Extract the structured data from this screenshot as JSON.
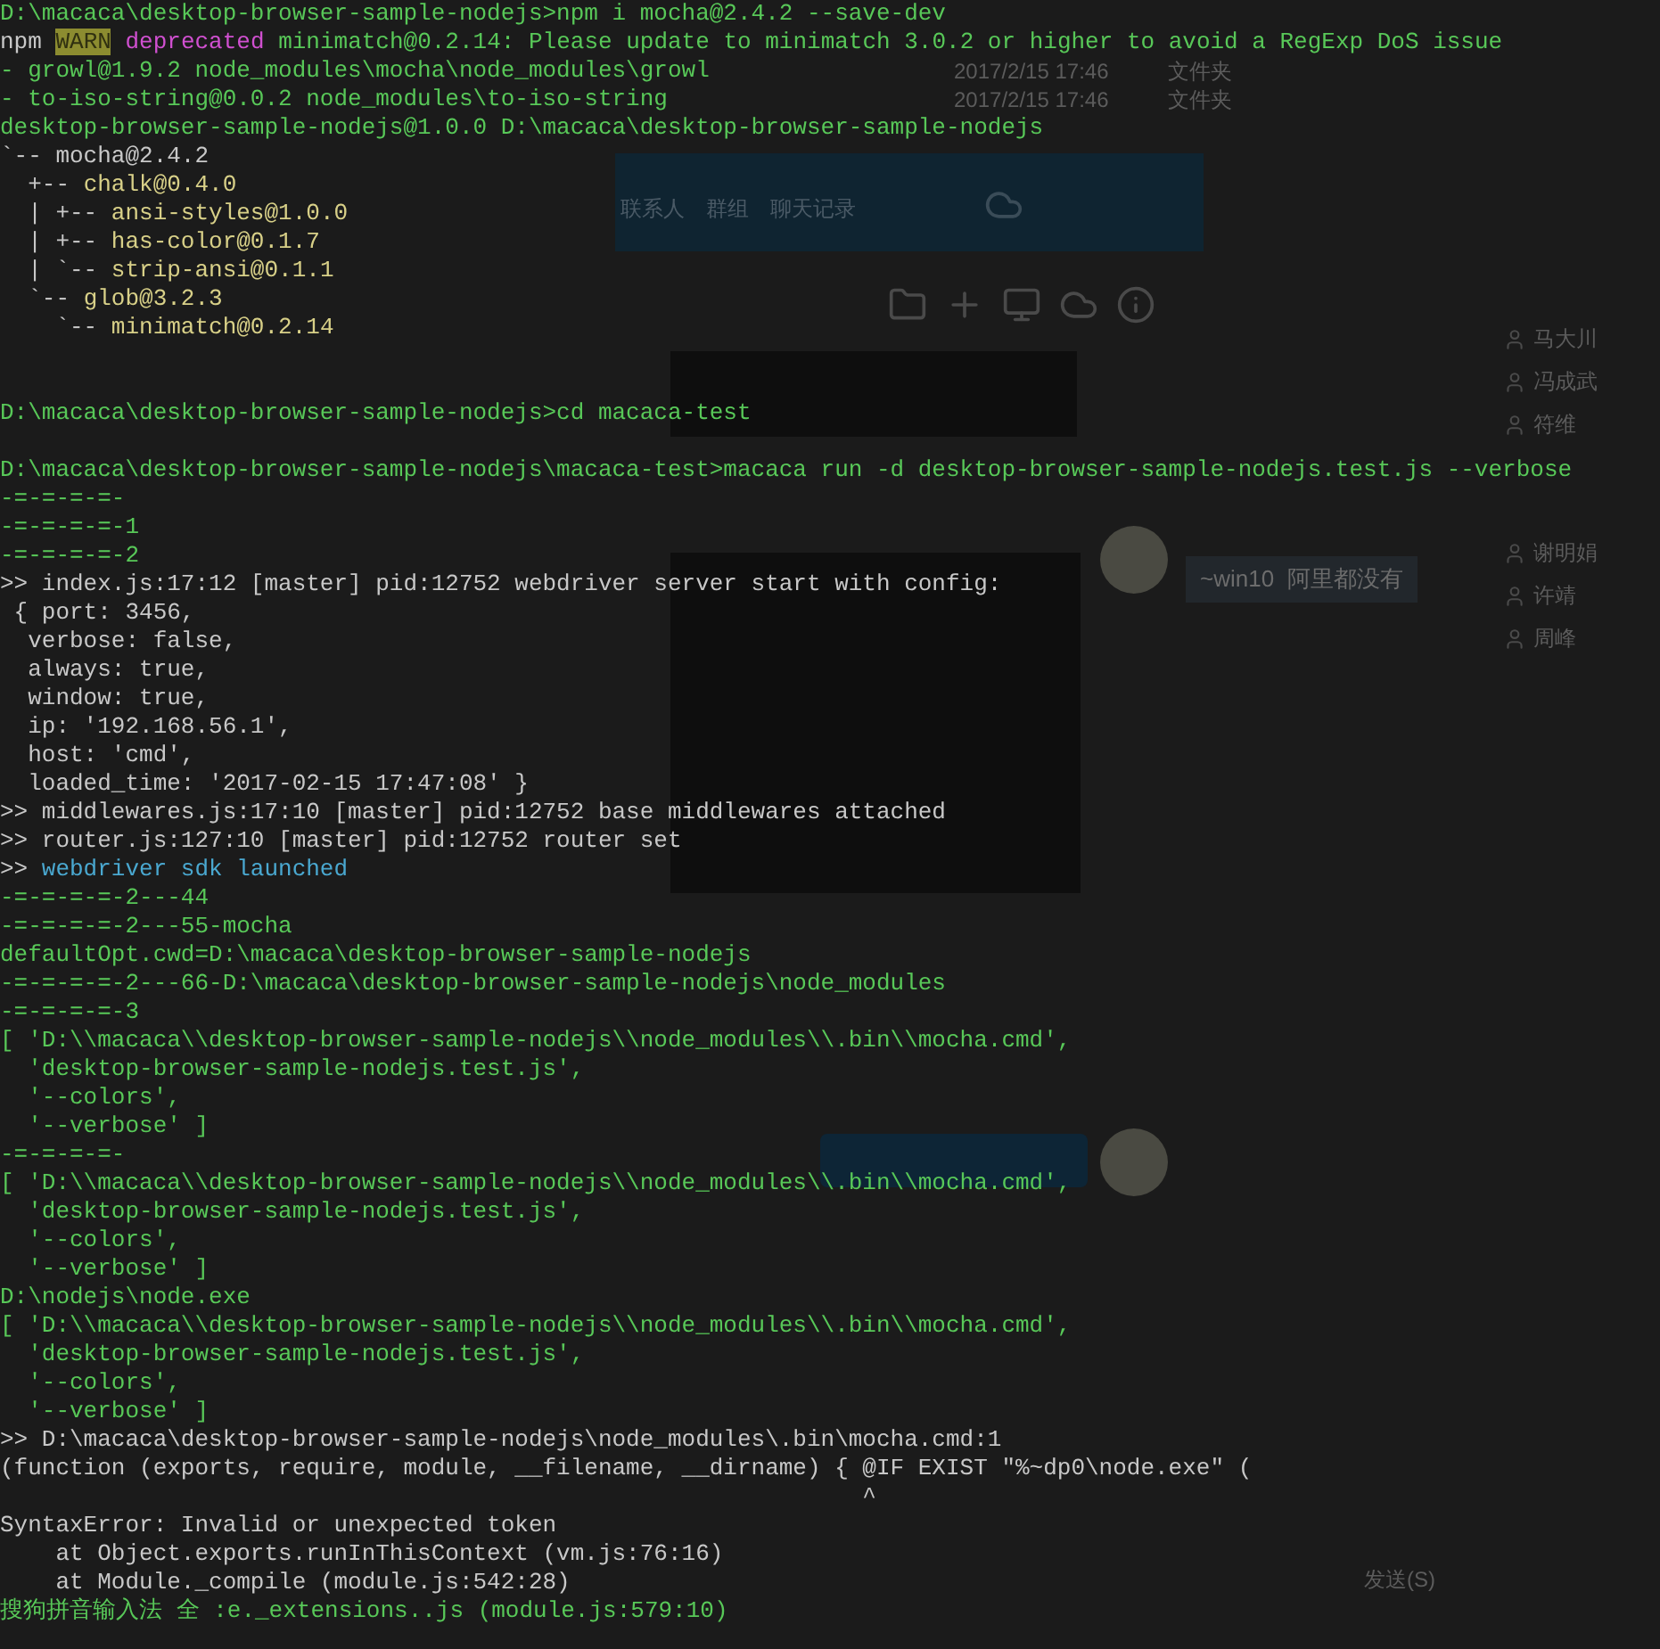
{
  "background_app": {
    "file_rows": [
      {
        "date": "2017/2/15 17:46",
        "type": "文件夹"
      },
      {
        "date": "2017/2/15 17:46",
        "type": "文件夹"
      }
    ],
    "tabs": [
      {
        "label": "联系人",
        "selected": false
      },
      {
        "label": "群组",
        "selected": false
      },
      {
        "label": "聊天记录",
        "selected": false
      }
    ],
    "contacts": [
      "马大川",
      "冯成武",
      "符维",
      "谢明娟",
      "许靖",
      "周峰"
    ],
    "message": "~win10  阿里都没有",
    "send_button": "发送(S)"
  },
  "terminal": {
    "lines": [
      {
        "segments": [
          {
            "kind": "prompt",
            "text": "D:\\macaca\\desktop-browser-sample-nodejs>npm i mocha@2.4.2 --save-dev"
          }
        ]
      },
      {
        "segments": [
          {
            "kind": "plain",
            "text": "npm "
          },
          {
            "kind": "warn",
            "text": "WARN"
          },
          {
            "kind": "deprecated",
            "text": " deprecated"
          },
          {
            "kind": "prompt",
            "text": " minimatch@0.2.14: Please update to minimatch 3.0.2 or higher to avoid a RegExp DoS issue"
          }
        ]
      },
      {
        "segments": [
          {
            "kind": "prompt",
            "text": "- growl@1.9.2 node_modules\\mocha\\node_modules\\growl"
          }
        ]
      },
      {
        "segments": [
          {
            "kind": "prompt",
            "text": "- to-iso-string@0.0.2 node_modules\\to-iso-string"
          }
        ]
      },
      {
        "segments": [
          {
            "kind": "prompt",
            "text": "desktop-browser-sample-nodejs@1.0.0 D:\\macaca\\desktop-browser-sample-nodejs"
          }
        ]
      },
      {
        "segments": [
          {
            "kind": "plain",
            "text": "`-- mocha@2.4.2"
          }
        ]
      },
      {
        "segments": [
          {
            "kind": "plain",
            "text": "  +-- "
          },
          {
            "kind": "tree",
            "text": "chalk@0.4.0"
          }
        ]
      },
      {
        "segments": [
          {
            "kind": "plain",
            "text": "  | +-- "
          },
          {
            "kind": "tree",
            "text": "ansi-styles@1.0.0"
          }
        ]
      },
      {
        "segments": [
          {
            "kind": "plain",
            "text": "  | +-- "
          },
          {
            "kind": "tree",
            "text": "has-color@0.1.7"
          }
        ]
      },
      {
        "segments": [
          {
            "kind": "plain",
            "text": "  | `-- "
          },
          {
            "kind": "tree",
            "text": "strip-ansi@0.1.1"
          }
        ]
      },
      {
        "segments": [
          {
            "kind": "plain",
            "text": "  `-- "
          },
          {
            "kind": "tree",
            "text": "glob@3.2.3"
          }
        ]
      },
      {
        "segments": [
          {
            "kind": "plain",
            "text": "    `-- "
          },
          {
            "kind": "tree",
            "text": "minimatch@0.2.14"
          }
        ]
      },
      {
        "kind": "blank"
      },
      {
        "kind": "blank"
      },
      {
        "segments": [
          {
            "kind": "prompt",
            "text": "D:\\macaca\\desktop-browser-sample-nodejs>cd macaca-test"
          }
        ]
      },
      {
        "kind": "blank"
      },
      {
        "segments": [
          {
            "kind": "prompt",
            "text": "D:\\macaca\\desktop-browser-sample-nodejs\\macaca-test>macaca run -d desktop-browser-sample-nodejs.test.js --verbose"
          }
        ]
      },
      {
        "segments": [
          {
            "kind": "prompt",
            "text": "-=-=-=-=-"
          }
        ]
      },
      {
        "segments": [
          {
            "kind": "prompt",
            "text": "-=-=-=-=-1"
          }
        ]
      },
      {
        "segments": [
          {
            "kind": "prompt",
            "text": "-=-=-=-=-2"
          }
        ]
      },
      {
        "segments": [
          {
            "kind": "plain",
            "text": ">> index.js:17:12 [master] pid:12752 webdriver server start with config:"
          }
        ]
      },
      {
        "segments": [
          {
            "kind": "plain",
            "text": " { port: 3456,"
          }
        ]
      },
      {
        "segments": [
          {
            "kind": "plain",
            "text": "  verbose: false,"
          }
        ]
      },
      {
        "segments": [
          {
            "kind": "plain",
            "text": "  always: true,"
          }
        ]
      },
      {
        "segments": [
          {
            "kind": "plain",
            "text": "  window: true,"
          }
        ]
      },
      {
        "segments": [
          {
            "kind": "plain",
            "text": "  ip: '192.168.56.1',"
          }
        ]
      },
      {
        "segments": [
          {
            "kind": "plain",
            "text": "  host: 'cmd',"
          }
        ]
      },
      {
        "segments": [
          {
            "kind": "plain",
            "text": "  loaded_time: '2017-02-15 17:47:08' }"
          }
        ]
      },
      {
        "segments": [
          {
            "kind": "plain",
            "text": ">> middlewares.js:17:10 [master] pid:12752 base middlewares attached"
          }
        ]
      },
      {
        "segments": [
          {
            "kind": "plain",
            "text": ">> router.js:127:10 [master] pid:12752 router set"
          }
        ]
      },
      {
        "segments": [
          {
            "kind": "plain",
            "text": ">> "
          },
          {
            "kind": "info",
            "text": "webdriver sdk launched"
          }
        ]
      },
      {
        "segments": [
          {
            "kind": "prompt",
            "text": "-=-=-=-=-2---44"
          }
        ]
      },
      {
        "segments": [
          {
            "kind": "prompt",
            "text": "-=-=-=-=-2---55-mocha"
          }
        ]
      },
      {
        "segments": [
          {
            "kind": "prompt",
            "text": "defaultOpt.cwd=D:\\macaca\\desktop-browser-sample-nodejs"
          }
        ]
      },
      {
        "segments": [
          {
            "kind": "prompt",
            "text": "-=-=-=-=-2---66-D:\\macaca\\desktop-browser-sample-nodejs\\node_modules"
          }
        ]
      },
      {
        "segments": [
          {
            "kind": "prompt",
            "text": "-=-=-=-=-3"
          }
        ]
      },
      {
        "segments": [
          {
            "kind": "prompt",
            "text": "[ 'D:\\\\macaca\\\\desktop-browser-sample-nodejs\\\\node_modules\\\\.bin\\\\mocha.cmd',"
          }
        ]
      },
      {
        "segments": [
          {
            "kind": "prompt",
            "text": "  'desktop-browser-sample-nodejs.test.js',"
          }
        ]
      },
      {
        "segments": [
          {
            "kind": "prompt",
            "text": "  '--colors',"
          }
        ]
      },
      {
        "segments": [
          {
            "kind": "prompt",
            "text": "  '--verbose' ]"
          }
        ]
      },
      {
        "segments": [
          {
            "kind": "prompt",
            "text": "-=-=-=-=-"
          }
        ]
      },
      {
        "segments": [
          {
            "kind": "prompt",
            "text": "[ 'D:\\\\macaca\\\\desktop-browser-sample-nodejs\\\\node_modules\\\\.bin\\\\mocha.cmd',"
          }
        ]
      },
      {
        "segments": [
          {
            "kind": "prompt",
            "text": "  'desktop-browser-sample-nodejs.test.js',"
          }
        ]
      },
      {
        "segments": [
          {
            "kind": "prompt",
            "text": "  '--colors',"
          }
        ]
      },
      {
        "segments": [
          {
            "kind": "prompt",
            "text": "  '--verbose' ]"
          }
        ]
      },
      {
        "segments": [
          {
            "kind": "prompt",
            "text": "D:\\nodejs\\node.exe"
          }
        ]
      },
      {
        "segments": [
          {
            "kind": "prompt",
            "text": "[ 'D:\\\\macaca\\\\desktop-browser-sample-nodejs\\\\node_modules\\\\.bin\\\\mocha.cmd',"
          }
        ]
      },
      {
        "segments": [
          {
            "kind": "prompt",
            "text": "  'desktop-browser-sample-nodejs.test.js',"
          }
        ]
      },
      {
        "segments": [
          {
            "kind": "prompt",
            "text": "  '--colors',"
          }
        ]
      },
      {
        "segments": [
          {
            "kind": "prompt",
            "text": "  '--verbose' ]"
          }
        ]
      },
      {
        "segments": [
          {
            "kind": "plain",
            "text": ">> D:\\macaca\\desktop-browser-sample-nodejs\\node_modules\\.bin\\mocha.cmd:1"
          }
        ]
      },
      {
        "segments": [
          {
            "kind": "plain",
            "text": "(function (exports, require, module, __filename, __dirname) { @IF EXIST \"%~dp0\\node.exe\" ("
          }
        ]
      },
      {
        "segments": [
          {
            "kind": "plain",
            "text": "                                                              ^"
          }
        ]
      },
      {
        "segments": [
          {
            "kind": "plain",
            "text": "SyntaxError: Invalid or unexpected token"
          }
        ]
      },
      {
        "segments": [
          {
            "kind": "plain",
            "text": "    at Object.exports.runInThisContext (vm.js:76:16)"
          }
        ]
      },
      {
        "segments": [
          {
            "kind": "plain",
            "text": "    at Module._compile (module.js:542:28)"
          }
        ]
      },
      {
        "segments": [
          {
            "kind": "prompt",
            "text": "搜狗拼音输入法 全 :e._extensions..js (module.js:579:10)"
          }
        ]
      }
    ]
  }
}
